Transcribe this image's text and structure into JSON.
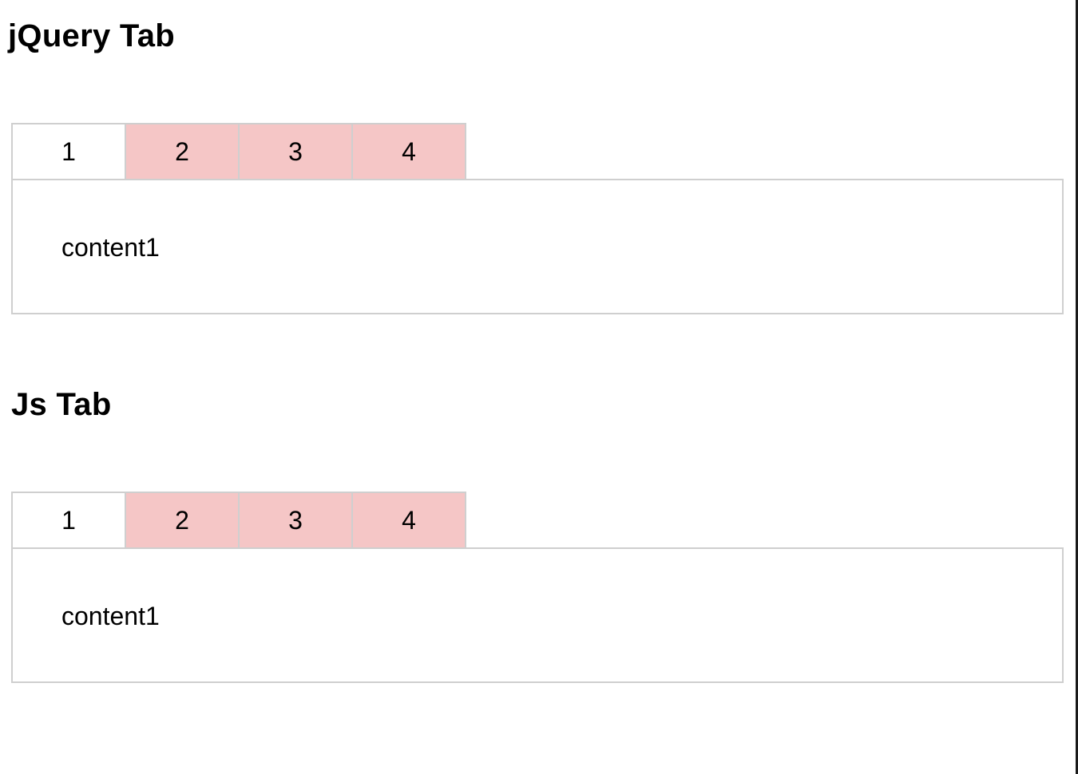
{
  "jquery_section": {
    "title": "jQuery Tab",
    "tabs": [
      {
        "label": "1",
        "active": true
      },
      {
        "label": "2",
        "active": false
      },
      {
        "label": "3",
        "active": false
      },
      {
        "label": "4",
        "active": false
      }
    ],
    "content": "content1"
  },
  "js_section": {
    "title": "Js Tab",
    "tabs": [
      {
        "label": "1",
        "active": true
      },
      {
        "label": "2",
        "active": false
      },
      {
        "label": "3",
        "active": false
      },
      {
        "label": "4",
        "active": false
      }
    ],
    "content": "content1"
  },
  "colors": {
    "inactive_tab": "#f5c6c6",
    "active_tab": "#ffffff",
    "border": "#cfcfcf"
  }
}
